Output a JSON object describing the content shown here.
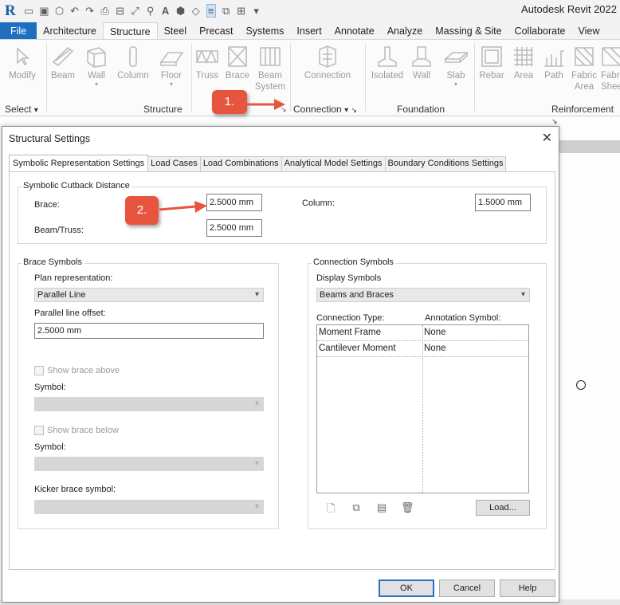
{
  "app": {
    "logo": "R",
    "title": "Autodesk Revit 2022"
  },
  "ribbon_tabs": [
    "File",
    "Architecture",
    "Structure",
    "Steel",
    "Precast",
    "Systems",
    "Insert",
    "Annotate",
    "Analyze",
    "Massing & Site",
    "Collaborate",
    "View"
  ],
  "ribbon": {
    "modify": "Modify",
    "beam": "Beam",
    "wall": "Wall",
    "column": "Column",
    "floor": "Floor",
    "truss": "Truss",
    "brace": "Brace",
    "beam_system_1": "Beam",
    "beam_system_2": "System",
    "connection": "Connection",
    "isolated": "Isolated",
    "wall_found": "Wall",
    "slab": "Slab",
    "rebar": "Rebar",
    "area": "Area",
    "path": "Path",
    "fabric_area_1": "Fabric",
    "fabric_area_2": "Area",
    "fabric_sheet_1": "Fabr",
    "fabric_sheet_2": "Shee",
    "panels": {
      "select": "Select",
      "structure": "Structure",
      "connection": "Connection",
      "foundation": "Foundation",
      "reinforcement": "Reinforcement"
    }
  },
  "callouts": {
    "one": "1.",
    "two": "2."
  },
  "dialog": {
    "title": "Structural Settings",
    "tabs": [
      "Symbolic Representation Settings",
      "Load Cases",
      "Load Combinations",
      "Analytical Model Settings",
      "Boundary Conditions Settings"
    ],
    "cutback": {
      "legend": "Symbolic Cutback Distance",
      "brace_label": "Brace:",
      "brace_value": "2.5000 mm",
      "beam_label": "Beam/Truss:",
      "beam_value": "2.5000 mm",
      "column_label": "Column:",
      "column_value": "1.5000 mm"
    },
    "brace_symbols": {
      "legend": "Brace Symbols",
      "plan_label": "Plan representation:",
      "plan_value": "Parallel Line",
      "offset_label": "Parallel line offset:",
      "offset_value": "2.5000 mm",
      "show_above": "Show brace above",
      "symbol_label_1": "Symbol:",
      "show_below": "Show brace below",
      "symbol_label_2": "Symbol:",
      "kicker_label": "Kicker brace symbol:"
    },
    "connection_symbols": {
      "legend": "Connection Symbols",
      "display_label": "Display Symbols",
      "display_value": "Beams and Braces",
      "col_type": "Connection Type:",
      "col_symbol": "Annotation Symbol:",
      "rows": [
        {
          "type": "Moment Frame",
          "symbol": "None"
        },
        {
          "type": "Cantilever Moment",
          "symbol": "None"
        }
      ],
      "load_button": "Load..."
    },
    "buttons": {
      "ok": "OK",
      "cancel": "Cancel",
      "help": "Help"
    }
  },
  "colors": {
    "file_tab": "#1f6fc1",
    "callout": "#e8553f"
  }
}
